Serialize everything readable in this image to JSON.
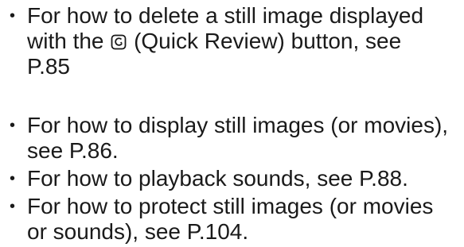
{
  "bullets": [
    {
      "lines": [
        "For how to delete a still image displayed",
        "with the",
        "(Quick Review) button, see",
        "P.85"
      ],
      "icon": "quick-review-icon"
    },
    {
      "lines": [
        "For how to display still images (or movies),",
        "see P.86."
      ]
    },
    {
      "lines": [
        "For how to playback sounds, see P.88."
      ]
    },
    {
      "lines": [
        "For how to protect still images (or movies",
        "or sounds), see P.104."
      ]
    }
  ],
  "bullet_char": "•"
}
